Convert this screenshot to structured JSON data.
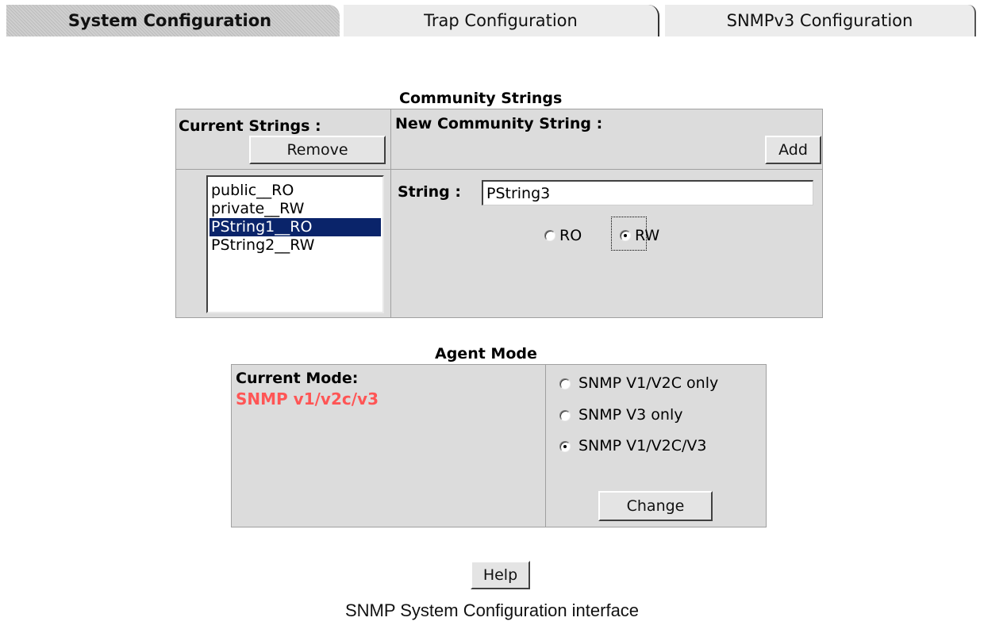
{
  "tabs": [
    {
      "label": "System Configuration",
      "active": true
    },
    {
      "label": "Trap Configuration",
      "active": false
    },
    {
      "label": "SNMPv3 Configuration",
      "active": false
    }
  ],
  "community": {
    "title": "Community Strings",
    "current_label": "Current Strings :",
    "new_label": "New Community String :",
    "remove_button": "Remove",
    "add_button": "Add",
    "strings": [
      "public__RO",
      "private__RW",
      "PString1__RO",
      "PString2__RW"
    ],
    "selected_index": 2,
    "string_label": "String :",
    "string_value": "PString3",
    "access_options": [
      "RO",
      "RW"
    ],
    "access_selected": "RW"
  },
  "agent": {
    "title": "Agent Mode",
    "current_label": "Current Mode:",
    "current_value": "SNMP v1/v2c/v3",
    "current_value_color": "#ff5555",
    "options": [
      "SNMP V1/V2C only",
      "SNMP V3 only",
      "SNMP V1/V2C/V3"
    ],
    "selected_index": 2,
    "change_button": "Change"
  },
  "help_button": "Help",
  "caption": "SNMP System Configuration interface"
}
